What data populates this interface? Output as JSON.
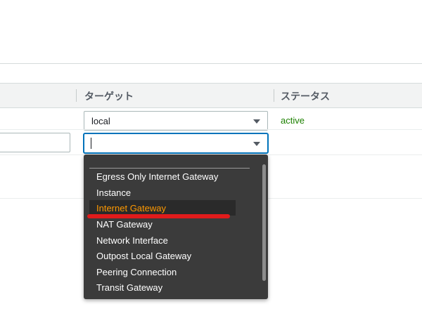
{
  "table": {
    "headers": {
      "target": "ターゲット",
      "status": "ステータス"
    },
    "rows": [
      {
        "target": "local",
        "status": "active"
      },
      {
        "target": "|",
        "status": ""
      }
    ]
  },
  "dropdown": {
    "options": [
      "Egress Only Internet Gateway",
      "Instance",
      "Internet Gateway",
      "NAT Gateway",
      "Network Interface",
      "Outpost Local Gateway",
      "Peering Connection",
      "Transit Gateway"
    ],
    "highlighted": "Internet Gateway"
  },
  "colors": {
    "status_active": "#1d8102",
    "highlight": "#ff9900",
    "annotation": "#e01b1b"
  }
}
